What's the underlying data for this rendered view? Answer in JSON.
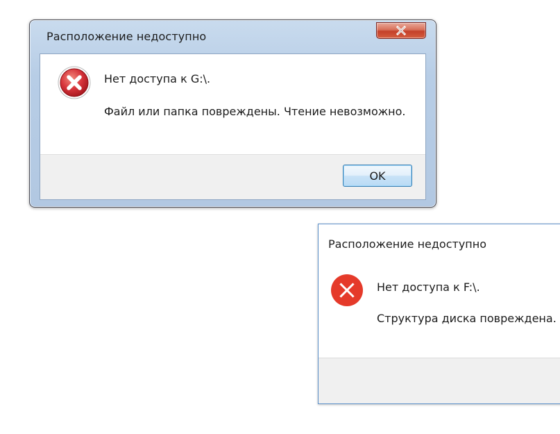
{
  "dialog_win7": {
    "title": "Расположение недоступно",
    "icon": "error-x-icon",
    "message_line1": "Нет доступа к G:\\.",
    "message_line2": "Файл или папка повреждены. Чтение невозможно.",
    "ok_label": "OK",
    "close_icon": "close-icon",
    "colors": {
      "frame": "#b7cde6",
      "close_button": "#c4402a",
      "error_icon": "#c8262c"
    }
  },
  "dialog_win10": {
    "title": "Расположение недоступно",
    "icon": "error-x-icon",
    "message_line1": "Нет доступа к F:\\.",
    "message_line2": "Структура диска повреждена. Ч",
    "colors": {
      "border": "#5b8fc9",
      "error_icon": "#e53a2a"
    }
  }
}
